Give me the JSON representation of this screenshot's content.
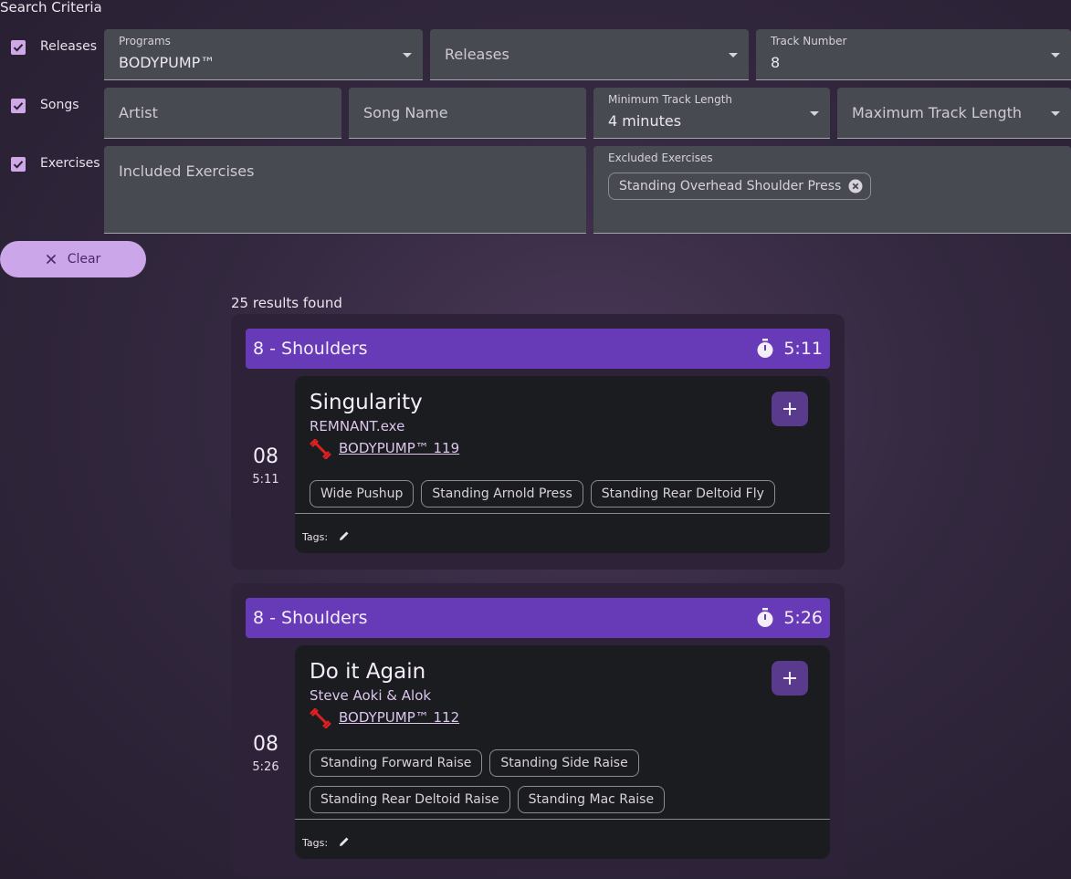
{
  "search": {
    "title": "Search Criteria",
    "rows": {
      "releases": "Releases",
      "songs": "Songs",
      "exercises": "Exercises"
    },
    "programs": {
      "label": "Programs",
      "value": "BODYPUMP™"
    },
    "releases_select": {
      "placeholder": "Releases"
    },
    "track_number": {
      "label": "Track Number",
      "value": "8"
    },
    "artist": {
      "placeholder": "Artist"
    },
    "song_name": {
      "placeholder": "Song Name"
    },
    "min_length": {
      "label": "Minimum Track Length",
      "value": "4 minutes"
    },
    "max_length": {
      "placeholder": "Maximum Track Length"
    },
    "included": {
      "placeholder": "Included Exercises"
    },
    "excluded": {
      "label": "Excluded Exercises",
      "chips": [
        "Standing Overhead Shoulder Press"
      ]
    },
    "clear_label": "Clear"
  },
  "results": {
    "count_text": "25 results found",
    "items": [
      {
        "header": "8 - Shoulders",
        "duration": "5:11",
        "track_number": "08",
        "track_length": "5:11",
        "title": "Singularity",
        "artist": "REMNANT.exe",
        "release": "BODYPUMP™ 119",
        "exercises": [
          "Wide Pushup",
          "Standing Arnold Press",
          "Standing Rear Deltoid Fly"
        ],
        "tags_label": "Tags:"
      },
      {
        "header": "8 - Shoulders",
        "duration": "5:26",
        "track_number": "08",
        "track_length": "5:26",
        "title": "Do it Again",
        "artist": "Steve Aoki & Alok",
        "release": "BODYPUMP™ 112",
        "exercises": [
          "Standing Forward Raise",
          "Standing Side Raise",
          "Standing Rear Deltoid Raise",
          "Standing Mac Raise"
        ],
        "tags_label": "Tags:"
      }
    ]
  },
  "colors": {
    "accent": "#673ab7",
    "checkbox": "#cfa8e6",
    "clear_button": "#cba6e8",
    "release_icon": "#e02020"
  },
  "icons": [
    "checkbox-icon",
    "dropdown-arrow-icon",
    "chip-remove-icon",
    "close-icon",
    "stopwatch-icon",
    "plus-icon",
    "dumbbell-icon",
    "edit-icon"
  ]
}
